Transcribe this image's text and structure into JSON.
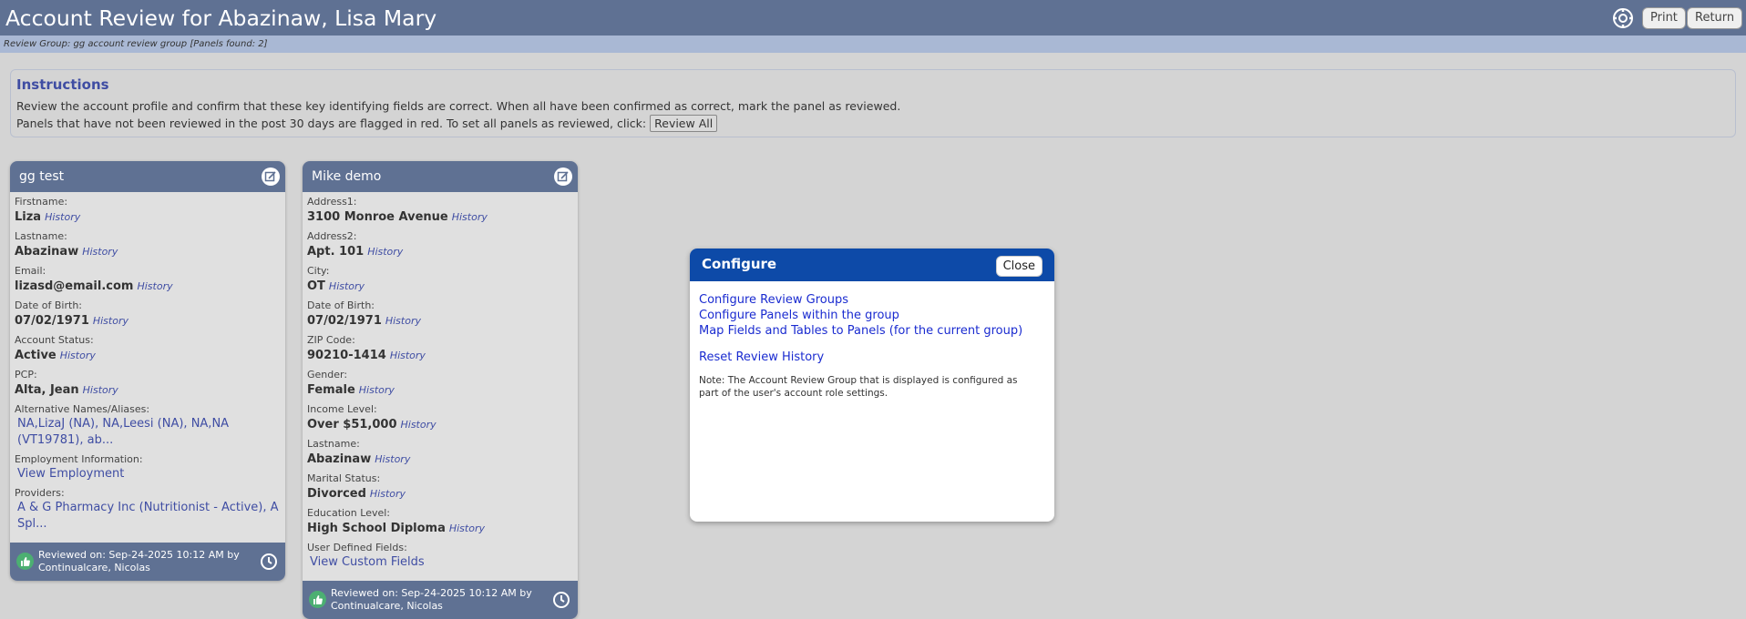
{
  "header": {
    "title": "Account Review for Abazinaw, Lisa Mary",
    "print_label": "Print",
    "return_label": "Return"
  },
  "subheader": {
    "text": "Review Group: gg account review group [Panels found: 2]"
  },
  "instructions": {
    "title": "Instructions",
    "line1": "Review the account profile and confirm that these key identifying fields are correct. When all have been confirmed as correct, mark the panel as reviewed.",
    "line2": "Panels that have not been reviewed in the post 30 days are flagged in red. To set all panels as reviewed, click:",
    "review_all_label": "Review All"
  },
  "history_label": "History",
  "panels": [
    {
      "title": "gg test",
      "fields": [
        {
          "label": "Firstname:",
          "value": "Liza"
        },
        {
          "label": "Lastname:",
          "value": "Abazinaw"
        },
        {
          "label": "Email:",
          "value": "lizasd@email.com"
        },
        {
          "label": "Date of Birth:",
          "value": "07/02/1971"
        },
        {
          "label": "Account Status:",
          "value": "Active"
        },
        {
          "label": "PCP:",
          "value": "Alta, Jean"
        }
      ],
      "links": [
        {
          "label": "Alternative Names/Aliases:",
          "value": "NA,LizaJ (NA), NA,Leesi (NA), NA,NA (VT19781), ab..."
        },
        {
          "label": "Employment Information:",
          "value": "View Employment"
        },
        {
          "label": "Providers:",
          "value": "A & G Pharmacy Inc (Nutritionist - Active), A Spl..."
        }
      ],
      "reviewed_line1": "Reviewed on: Sep-24-2025 10:12 AM by",
      "reviewed_line2": "Continualcare, Nicolas"
    },
    {
      "title": "Mike demo",
      "fields": [
        {
          "label": "Address1:",
          "value": "3100 Monroe Avenue"
        },
        {
          "label": "Address2:",
          "value": "Apt. 101"
        },
        {
          "label": "City:",
          "value": "OT"
        },
        {
          "label": "Date of Birth:",
          "value": "07/02/1971"
        },
        {
          "label": "ZIP Code:",
          "value": "90210-1414"
        },
        {
          "label": "Gender:",
          "value": "Female"
        },
        {
          "label": "Income Level:",
          "value": "Over $51,000"
        },
        {
          "label": "Lastname:",
          "value": "Abazinaw"
        },
        {
          "label": "Marital Status:",
          "value": "Divorced"
        },
        {
          "label": "Education Level:",
          "value": "High School Diploma"
        }
      ],
      "links": [
        {
          "label": "User Defined Fields:",
          "value": "View Custom Fields"
        }
      ],
      "reviewed_line1": "Reviewed on: Sep-24-2025 10:12 AM by",
      "reviewed_line2": "Continualcare, Nicolas"
    }
  ],
  "modal": {
    "title": "Configure",
    "close_label": "Close",
    "links": [
      "Configure Review Groups",
      "Configure Panels within the group",
      "Map Fields and Tables to Panels (for the current group)"
    ],
    "reset_link": "Reset Review History",
    "note": "Note: The Account Review Group that is displayed is configured as part of the user's account role settings."
  }
}
